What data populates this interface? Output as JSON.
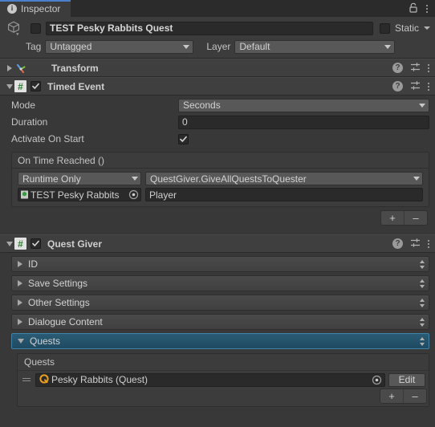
{
  "window": {
    "tab_label": "Inspector",
    "tab_icon": "info-icon",
    "lock_icon": "lock-icon",
    "menu_icon": "kebab-menu-icon"
  },
  "gameobject": {
    "icon": "gameobject-cube-icon",
    "active_checked": false,
    "name": "TEST Pesky Rabbits Quest",
    "static_label": "Static",
    "static_checked": false,
    "tag_label": "Tag",
    "tag_value": "Untagged",
    "layer_label": "Layer",
    "layer_value": "Default"
  },
  "components": [
    {
      "title": "Transform",
      "icon": "transform-axis-icon",
      "expanded": false,
      "has_enable_toggle": false
    },
    {
      "title": "Timed Event",
      "icon": "csharp-script-icon",
      "expanded": true,
      "has_enable_toggle": true,
      "enabled": true
    },
    {
      "title": "Quest Giver",
      "icon": "csharp-script-icon",
      "expanded": true,
      "has_enable_toggle": true,
      "enabled": true
    }
  ],
  "header_icons": {
    "help": "?",
    "help_name": "help-icon",
    "preset": "preset-settings-icon",
    "menu": "kebab-menu-icon"
  },
  "timed_event": {
    "mode": {
      "label": "Mode",
      "value": "Seconds"
    },
    "duration": {
      "label": "Duration",
      "value": "0"
    },
    "activate_on_start": {
      "label": "Activate On Start",
      "checked": true
    },
    "event": {
      "title": "On Time Reached ()",
      "entries": [
        {
          "call_state": "Runtime Only",
          "method": "QuestGiver.GiveAllQuestsToQuester",
          "target_object": "TEST Pesky Rabbits",
          "target_icon": "prefab-gameobject-icon",
          "argument": "Player"
        }
      ],
      "add_label": "+",
      "remove_label": "–"
    }
  },
  "quest_giver": {
    "sections": [
      {
        "label": "ID",
        "expanded": false,
        "selected": false
      },
      {
        "label": "Save Settings",
        "expanded": false,
        "selected": false
      },
      {
        "label": "Other Settings",
        "expanded": false,
        "selected": false
      },
      {
        "label": "Dialogue Content",
        "expanded": false,
        "selected": false
      },
      {
        "label": "Quests",
        "expanded": true,
        "selected": true
      }
    ],
    "quests_list": {
      "title": "Quests",
      "items": [
        {
          "name": "Pesky Rabbits (Quest)",
          "icon": "quest-asset-icon",
          "edit_label": "Edit"
        }
      ],
      "add_label": "+",
      "remove_label": "–"
    }
  },
  "colors": {
    "background": "#383838",
    "header": "#3c3c3c",
    "field": "#2a2a2a",
    "dropdown": "#585858",
    "accent_blue": "#4b7fcc",
    "selected_row": "#2b5b75",
    "script_green": "#2d7d33",
    "quest_orange": "#e8a022"
  }
}
